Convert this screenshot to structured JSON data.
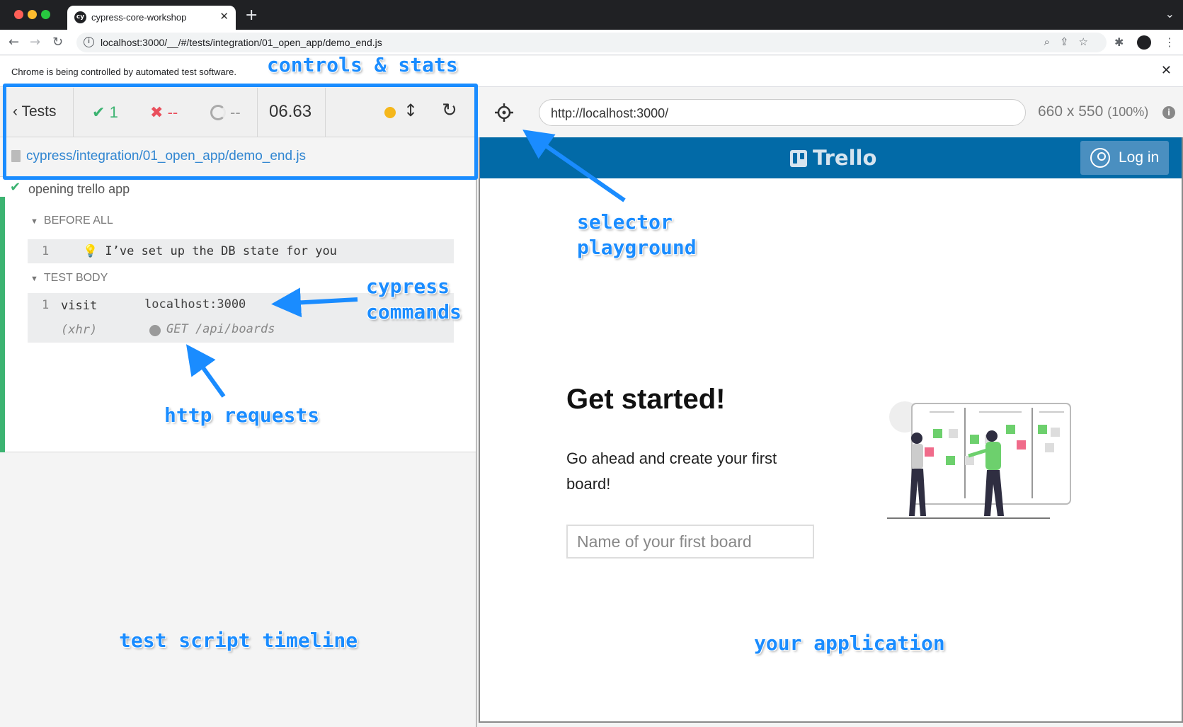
{
  "browser": {
    "tab_title": "cypress-core-workshop",
    "url": "localhost:3000/__/#/tests/integration/01_open_app/demo_end.js",
    "infobar_text": "Chrome is being controlled by automated test software."
  },
  "reporter": {
    "tests_label": "Tests",
    "passed": "1",
    "failed": "--",
    "pending": "--",
    "duration": "06.63",
    "spec_path": "cypress/integration/01_open_app/demo_end.js",
    "suite_title": "opening trello app",
    "before_all_label": "BEFORE ALL",
    "before_all_commands": [
      {
        "num": "1",
        "message": "💡 I’ve set up the DB state for you"
      }
    ],
    "test_body_label": "TEST BODY",
    "test_commands": [
      {
        "num": "1",
        "name": "visit",
        "arg": "localhost:3000"
      },
      {
        "num": "",
        "name": "(xhr)",
        "arg": "GET /api/boards"
      }
    ]
  },
  "aut": {
    "url": "http://localhost:3000/",
    "viewport": "660 x 550",
    "viewport_scale": "(100%)",
    "app": {
      "brand": "Trello",
      "login_label": "Log in",
      "heading": "Get started!",
      "subtext": "Go ahead and create your first board!",
      "input_placeholder": "Name of your first board"
    }
  },
  "annotations": {
    "controls_stats": "controls & stats",
    "selector_playground": "selector\nplayground",
    "cypress_commands": "cypress\ncommands",
    "http_requests": "http requests",
    "test_script_timeline": "test script timeline",
    "your_application": "your application"
  },
  "colors": {
    "passed": "#3cb371",
    "failed": "#e94f5c",
    "running": "#f5b71b",
    "link": "#3186d1",
    "trello_header": "#026aa7",
    "annotation": "#1a8cff"
  }
}
